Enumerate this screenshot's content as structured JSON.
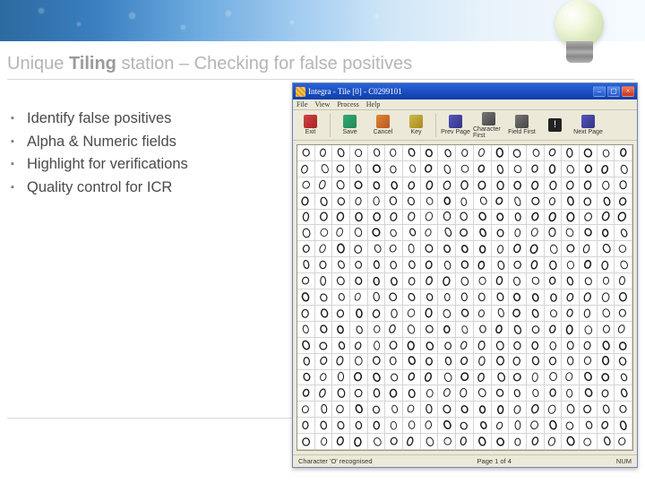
{
  "slide": {
    "title_prefix": "Unique ",
    "title_bold": "Tiling",
    "title_suffix": " station – Checking for false positives"
  },
  "bullets": [
    "Identify false positives",
    "Alpha & Numeric fields",
    "Highlight for verifications",
    "Quality control for ICR"
  ],
  "app": {
    "title": "Integra - Tile [0] - C0299101",
    "menu": [
      "File",
      "View",
      "Process",
      "Help"
    ],
    "toolbar": [
      {
        "name": "exit",
        "label": "Exit",
        "iconClass": "ico-exit"
      },
      {
        "sep": true
      },
      {
        "name": "save",
        "label": "Save",
        "iconClass": "ico-save"
      },
      {
        "name": "cancel",
        "label": "Cancel",
        "iconClass": "ico-cancel"
      },
      {
        "name": "key",
        "label": "Key",
        "iconClass": "ico-key"
      },
      {
        "sep": true
      },
      {
        "name": "prev-page",
        "label": "Prev Page",
        "iconClass": "ico-prev"
      },
      {
        "name": "char-first",
        "label": "Character First",
        "iconClass": "ico-char"
      },
      {
        "name": "field-first",
        "label": "Field First",
        "iconClass": "ico-field"
      },
      {
        "name": "flag",
        "label": "",
        "iconClass": "ico-flag",
        "glyph": "!"
      },
      {
        "name": "next-page",
        "label": "Next Page",
        "iconClass": "ico-next"
      }
    ],
    "status_left": "Character 'O' recognised",
    "status_mid": "Page 1 of 4",
    "status_right": "NUM",
    "grid": {
      "cols": 19,
      "rows": 19,
      "glyph": "0"
    }
  }
}
